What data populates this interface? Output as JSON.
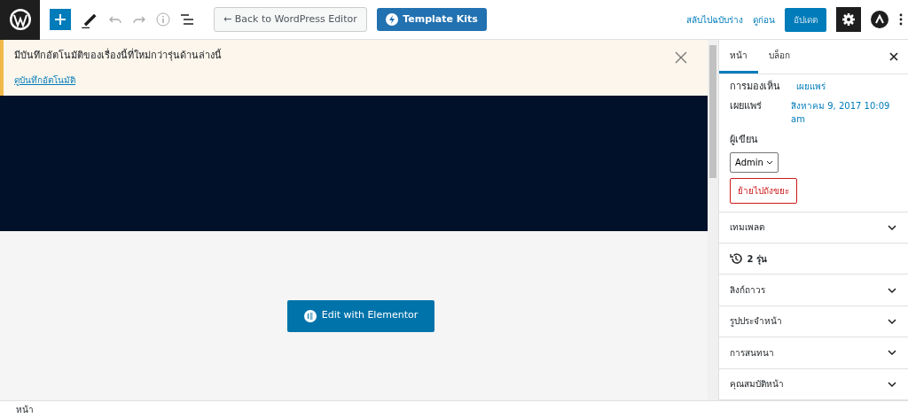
{
  "toolbar": {
    "back_button": "← Back to WordPress Editor",
    "template_kits_button": "Template Kits",
    "switch_to_draft": "สลับไปฉบับร่าง",
    "preview": "ดูก่อน",
    "update_button": "อัปเดต",
    "settings_active": true
  },
  "notice": {
    "message": "มีบันทึกอัตโนมัติของเรื่องนี้ที่ใหม่กว่ารุ่นด้านล่างนี้",
    "link": "ดูบันทึกอัตโนมัติ"
  },
  "editor": {
    "edit_button": "Edit with Elementor"
  },
  "sidebar": {
    "tabs": [
      {
        "label": "หน้า",
        "selected": true
      },
      {
        "label": "บล็อก",
        "selected": false
      }
    ],
    "visibility": {
      "label": "การมองเห็น",
      "value": "เผยแพร่"
    },
    "published": {
      "label": "เผยแพร่",
      "value": "สิงหาคม 9, 2017 10:09 am"
    },
    "author": {
      "label": "ผู้เขียน",
      "value": "Admin"
    },
    "trash_button": "ย้ายไปถังขยะ",
    "panels": [
      {
        "kind": "collapsible",
        "label": "เทมเพลต",
        "expanded": false
      },
      {
        "kind": "revisions",
        "label": "2 รุ่น"
      },
      {
        "kind": "collapsible",
        "label": "ลิงก์ถาวร",
        "expanded": false
      },
      {
        "kind": "collapsible",
        "label": "รูปประจำหน้า",
        "expanded": false
      },
      {
        "kind": "collapsible",
        "label": "การสนทนา",
        "expanded": false
      },
      {
        "kind": "collapsible",
        "label": "คุณสมบัติหน้า",
        "expanded": false
      }
    ]
  },
  "footer": {
    "breadcrumb": "หน้า"
  }
}
